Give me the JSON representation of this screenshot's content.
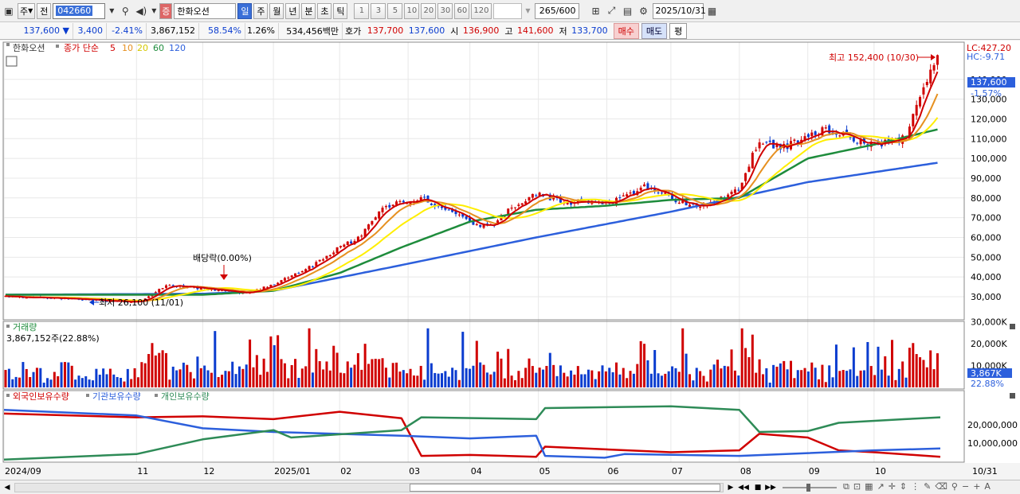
{
  "toolbar": {
    "market_label": "주",
    "prev_label": "전",
    "stock_code": "042660",
    "stock_badge": "증",
    "stock_name": "한화오션",
    "periods": [
      "일",
      "주",
      "월",
      "년",
      "분",
      "초",
      "틱"
    ],
    "intervals": [
      "1",
      "3",
      "5",
      "10",
      "20",
      "30",
      "60",
      "120"
    ],
    "count_value": "265",
    "count_total": "/600",
    "date_value": "2025/10/31"
  },
  "quote": {
    "price": "137,600",
    "arrow": "▼",
    "change": "3,400",
    "change_pct": "-2.41%",
    "volume": "3,867,152",
    "vol_ratio": "58.54%",
    "turnover": "1.26%",
    "amount": "534,456백만",
    "bid_label": "호가",
    "bid1": "137,700",
    "bid2": "137,600",
    "open_label": "시",
    "open": "136,900",
    "high_label": "고",
    "high": "141,600",
    "low_label": "저",
    "low": "133,700",
    "buy_label": "매수",
    "sell_label": "매도",
    "eval_label": "평"
  },
  "main_pane": {
    "stock_label": "한화오션",
    "ma_title": "종가 단순",
    "ma_periods": [
      "5",
      "10",
      "20",
      "60",
      "120"
    ],
    "lc_label": "LC:427.20",
    "hc_label": "HC:-9.71",
    "price_badge": "137,600",
    "price_pct": "-1.57%",
    "high_annot": "최고 152,400 (10/30)",
    "low_annot": "최저 26,100 (11/01)",
    "div_annot": "배당락(0.00%)"
  },
  "volume_pane": {
    "title": "거래량",
    "info": "3,867,152주(22.88%)",
    "badge_value": "3,867K",
    "badge_pct": "22.88%"
  },
  "holdings_pane": {
    "legend": [
      "외국인보유수량",
      "기관보유수량",
      "개인보유수량"
    ]
  },
  "x_axis": {
    "labels": [
      "2024/09",
      "11",
      "12",
      "2025/01",
      "02",
      "03",
      "04",
      "05",
      "06",
      "07",
      "08",
      "09",
      "10"
    ],
    "last_label": "10/31"
  },
  "colors": {
    "up": "#d00000",
    "down": "#0a3ccf",
    "ma5": "#d00000",
    "ma10": "#e69020",
    "ma20": "#ffee00",
    "ma60": "#1e8c3c",
    "ma120": "#2c5fdc",
    "foreign": "#d00000",
    "institution": "#2c5fdc",
    "individual": "#2e8b57",
    "grid": "#e8e8e8"
  },
  "chart_data": {
    "type": "candlestick",
    "x_range": [
      "2024/09",
      "2025/10/31"
    ],
    "price_axis": {
      "ticks": [
        "30,000",
        "40,000",
        "50,000",
        "60,000",
        "70,000",
        "80,000",
        "90,000",
        "100,000",
        "110,000",
        "120,000",
        "130,000",
        "140,000"
      ],
      "range": [
        23000,
        160000
      ]
    },
    "close_path": [
      [
        "2024/09/02",
        30000
      ],
      [
        "2024/10/01",
        29000
      ],
      [
        "2024/11/01",
        27000
      ],
      [
        "2024/11/15",
        36000
      ],
      [
        "2024/12/01",
        34000
      ],
      [
        "2024/12/20",
        32000
      ],
      [
        "2025/01/02",
        36000
      ],
      [
        "2025/01/20",
        46000
      ],
      [
        "2025/02/01",
        55000
      ],
      [
        "2025/02/10",
        60000
      ],
      [
        "2025/02/20",
        75000
      ],
      [
        "2025/03/01",
        78000
      ],
      [
        "2025/03/10",
        80000
      ],
      [
        "2025/03/20",
        75000
      ],
      [
        "2025/04/01",
        68000
      ],
      [
        "2025/04/10",
        65000
      ],
      [
        "2025/04/20",
        75000
      ],
      [
        "2025/05/01",
        82000
      ],
      [
        "2025/05/15",
        78000
      ],
      [
        "2025/06/01",
        77000
      ],
      [
        "2025/06/20",
        86000
      ],
      [
        "2025/07/01",
        80000
      ],
      [
        "2025/07/15",
        75000
      ],
      [
        "2025/08/01",
        84000
      ],
      [
        "2025/08/10",
        110000
      ],
      [
        "2025/08/20",
        105000
      ],
      [
        "2025/09/01",
        112000
      ],
      [
        "2025/09/10",
        115000
      ],
      [
        "2025/09/20",
        110000
      ],
      [
        "2025/10/01",
        107000
      ],
      [
        "2025/10/15",
        110000
      ],
      [
        "2025/10/25",
        140000
      ],
      [
        "2025/10/30",
        152400
      ],
      [
        "2025/10/31",
        137600
      ]
    ],
    "ma120_path": [
      [
        "2024/09/02",
        31000
      ],
      [
        "2024/12/01",
        31500
      ],
      [
        "2025/01/02",
        33000
      ],
      [
        "2025/03/01",
        46000
      ],
      [
        "2025/05/01",
        60000
      ],
      [
        "2025/07/01",
        73000
      ],
      [
        "2025/09/01",
        88000
      ],
      [
        "2025/10/31",
        98000
      ]
    ],
    "ma60_path": [
      [
        "2024/09/02",
        31000
      ],
      [
        "2024/12/01",
        31000
      ],
      [
        "2025/01/02",
        33000
      ],
      [
        "2025/02/01",
        42000
      ],
      [
        "2025/03/01",
        55000
      ],
      [
        "2025/04/01",
        68000
      ],
      [
        "2025/05/01",
        74000
      ],
      [
        "2025/06/01",
        76000
      ],
      [
        "2025/07/01",
        79000
      ],
      [
        "2025/08/01",
        80000
      ],
      [
        "2025/09/01",
        100000
      ],
      [
        "2025/10/01",
        107000
      ],
      [
        "2025/10/31",
        115000
      ]
    ],
    "volume_axis": {
      "ticks": [
        "10,000K",
        "20,000K",
        "30,000K"
      ]
    },
    "holdings_axis": {
      "ticks": [
        "10,000,000",
        "20,000,000"
      ]
    },
    "holdings_series": [
      {
        "name": "외국인보유수량",
        "points": [
          [
            "2024/09/02",
            26000000
          ],
          [
            "2024/11/01",
            24000000
          ],
          [
            "2024/12/01",
            24500000
          ],
          [
            "2025/01/02",
            23000000
          ],
          [
            "2025/02/01",
            27000000
          ],
          [
            "2025/03/01",
            23500000
          ],
          [
            "2025/03/10",
            3000000
          ],
          [
            "2025/04/01",
            3500000
          ],
          [
            "2025/05/01",
            2500000
          ],
          [
            "2025/05/05",
            8000000
          ],
          [
            "2025/07/01",
            5000000
          ],
          [
            "2025/08/01",
            6000000
          ],
          [
            "2025/08/10",
            15000000
          ],
          [
            "2025/09/01",
            13000000
          ],
          [
            "2025/09/15",
            6000000
          ],
          [
            "2025/10/01",
            5000000
          ],
          [
            "2025/10/31",
            2500000
          ]
        ]
      },
      {
        "name": "기관보유수량",
        "points": [
          [
            "2024/09/02",
            28000000
          ],
          [
            "2024/11/01",
            25000000
          ],
          [
            "2024/12/01",
            18000000
          ],
          [
            "2025/01/02",
            16000000
          ],
          [
            "2025/03/01",
            14000000
          ],
          [
            "2025/04/01",
            12500000
          ],
          [
            "2025/05/01",
            14000000
          ],
          [
            "2025/05/05",
            3000000
          ],
          [
            "2025/06/01",
            2000000
          ],
          [
            "2025/06/10",
            4000000
          ],
          [
            "2025/08/01",
            3000000
          ],
          [
            "2025/09/01",
            4500000
          ],
          [
            "2025/10/01",
            6000000
          ],
          [
            "2025/10/31",
            7000000
          ]
        ]
      },
      {
        "name": "개인보유수량",
        "points": [
          [
            "2024/09/02",
            1000000
          ],
          [
            "2024/11/01",
            4000000
          ],
          [
            "2024/12/01",
            12000000
          ],
          [
            "2025/01/02",
            17000000
          ],
          [
            "2025/01/10",
            13000000
          ],
          [
            "2025/03/01",
            17000000
          ],
          [
            "2025/03/10",
            24000000
          ],
          [
            "2025/05/01",
            23000000
          ],
          [
            "2025/05/05",
            29000000
          ],
          [
            "2025/07/01",
            30000000
          ],
          [
            "2025/08/01",
            28000000
          ],
          [
            "2025/08/10",
            16000000
          ],
          [
            "2025/09/01",
            16500000
          ],
          [
            "2025/09/15",
            21000000
          ],
          [
            "2025/10/15",
            23000000
          ],
          [
            "2025/10/31",
            24000000
          ]
        ]
      }
    ]
  }
}
